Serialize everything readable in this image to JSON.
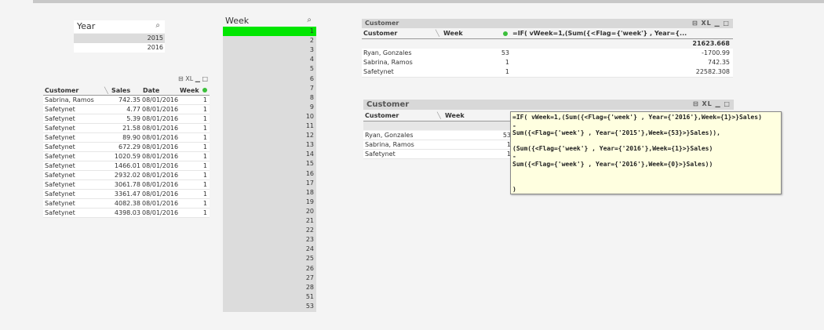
{
  "year_box": {
    "title": "Year",
    "values": [
      "2015",
      "2016"
    ]
  },
  "week_list": {
    "title": "Week",
    "values": [
      "1",
      "2",
      "3",
      "4",
      "5",
      "6",
      "7",
      "8",
      "9",
      "10",
      "11",
      "12",
      "13",
      "14",
      "15",
      "16",
      "17",
      "18",
      "19",
      "20",
      "21",
      "22",
      "23",
      "24",
      "25",
      "26",
      "27",
      "28",
      "51",
      "53"
    ]
  },
  "table_box": {
    "icons": "⊟ XL ▁ □",
    "headers": [
      "Customer",
      "Sales",
      "Date",
      "Week"
    ],
    "rows": [
      [
        "Sabrina, Ramos",
        "742.35",
        "08/01/2016",
        "1"
      ],
      [
        "Safetynet",
        "4.77",
        "08/01/2016",
        "1"
      ],
      [
        "Safetynet",
        "5.39",
        "08/01/2016",
        "1"
      ],
      [
        "Safetynet",
        "21.58",
        "08/01/2016",
        "1"
      ],
      [
        "Safetynet",
        "89.90",
        "08/01/2016",
        "1"
      ],
      [
        "Safetynet",
        "672.29",
        "08/01/2016",
        "1"
      ],
      [
        "Safetynet",
        "1020.59",
        "08/01/2016",
        "1"
      ],
      [
        "Safetynet",
        "1466.01",
        "08/01/2016",
        "1"
      ],
      [
        "Safetynet",
        "2932.02",
        "08/01/2016",
        "1"
      ],
      [
        "Safetynet",
        "3061.78",
        "08/01/2016",
        "1"
      ],
      [
        "Safetynet",
        "3361.47",
        "08/01/2016",
        "1"
      ],
      [
        "Safetynet",
        "4082.38",
        "08/01/2016",
        "1"
      ],
      [
        "Safetynet",
        "4398.03",
        "08/01/2016",
        "1"
      ]
    ]
  },
  "customer_box_1": {
    "title": "Customer",
    "icons": "⊟ XL ▁ □",
    "headers": [
      "Customer",
      "Week",
      "=IF( vWeek=1,(Sum({<Flag={'week'} , Year={..."
    ],
    "total": "21623.668",
    "rows": [
      [
        "Ryan, Gonzales",
        "53",
        "-1700.99"
      ],
      [
        "Sabrina, Ramos",
        "1",
        "742.35"
      ],
      [
        "Safetynet",
        "1",
        "22582.308"
      ]
    ]
  },
  "customer_box_2": {
    "title": "Customer",
    "icons": "⊟ XL ▁ □",
    "headers": [
      "Customer",
      "Week"
    ],
    "rows": [
      [
        "Ryan, Gonzales",
        "53"
      ],
      [
        "Sabrina, Ramos",
        "1"
      ],
      [
        "Safetynet",
        "1"
      ]
    ]
  },
  "tooltip": {
    "lines": [
      "=IF( vWeek=1,(Sum({<Flag={'week'} , Year={'2016'},Week={1}>}Sales)",
      "-",
      "Sum({<Flag={'week'} , Year={'2015'},Week={53}>}Sales)),",
      "(Sum({<Flag={'week'} , Year={'2016'},Week={1}>}Sales)",
      "-",
      "Sum({<Flag={'week'} , Year={'2016'},Week={0}>}Sales))",
      ")"
    ]
  },
  "colors": {
    "selected": "#00e600",
    "header": "#d8d8d8",
    "list_bg": "#dcdcdc",
    "tooltip_bg": "#ffffe0"
  }
}
